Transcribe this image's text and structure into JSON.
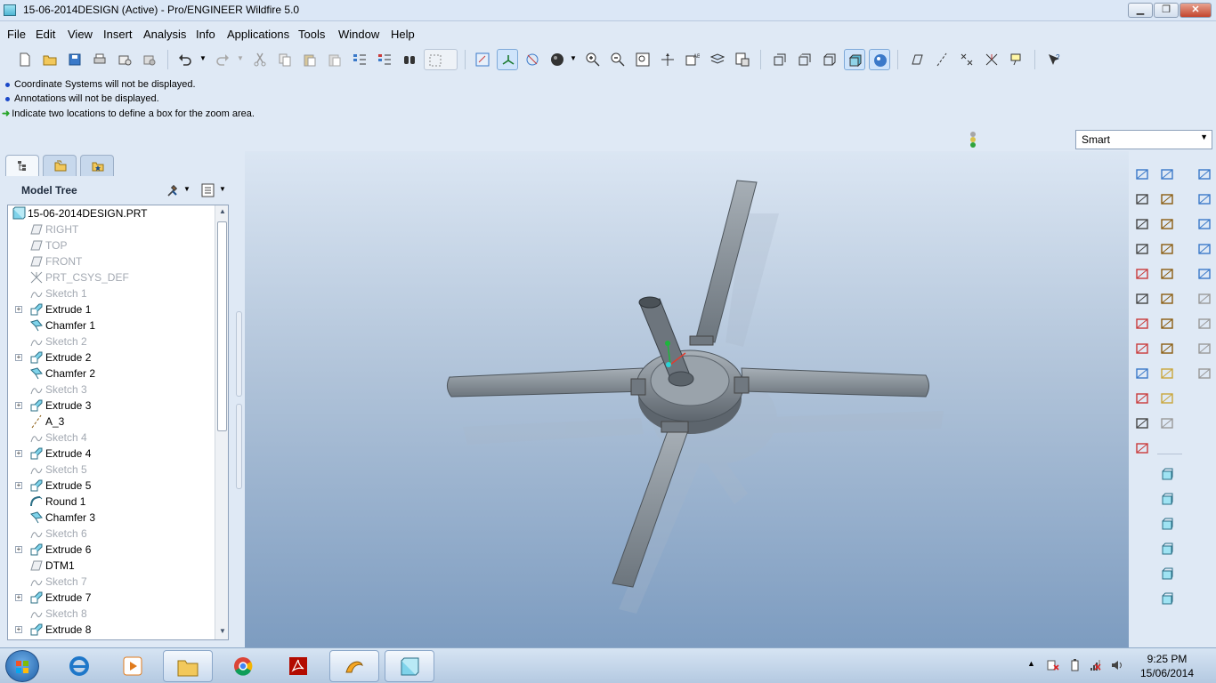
{
  "window": {
    "title": "15-06-2014DESIGN (Active) - Pro/ENGINEER Wildfire 5.0"
  },
  "menu": [
    "File",
    "Edit",
    "View",
    "Insert",
    "Analysis",
    "Info",
    "Applications",
    "Tools",
    "Window",
    "Help"
  ],
  "messages": [
    {
      "type": "info",
      "text": "Coordinate Systems will not be displayed."
    },
    {
      "type": "info",
      "text": "Annotations will not be displayed."
    },
    {
      "type": "prompt",
      "text": "Indicate two locations to define a box for the zoom area."
    }
  ],
  "filter": {
    "value": "Smart"
  },
  "model_tree": {
    "title": "Model Tree",
    "root": "15-06-2014DESIGN.PRT",
    "items": [
      {
        "label": "RIGHT",
        "icon": "datum-plane-icon",
        "dim": true,
        "expandable": false
      },
      {
        "label": "TOP",
        "icon": "datum-plane-icon",
        "dim": true,
        "expandable": false
      },
      {
        "label": "FRONT",
        "icon": "datum-plane-icon",
        "dim": true,
        "expandable": false
      },
      {
        "label": "PRT_CSYS_DEF",
        "icon": "csys-icon",
        "dim": true,
        "expandable": false
      },
      {
        "label": "Sketch 1",
        "icon": "sketch-icon",
        "dim": true,
        "expandable": false
      },
      {
        "label": "Extrude 1",
        "icon": "extrude-icon",
        "dim": false,
        "expandable": true
      },
      {
        "label": "Chamfer 1",
        "icon": "chamfer-icon",
        "dim": false,
        "expandable": false
      },
      {
        "label": "Sketch 2",
        "icon": "sketch-icon",
        "dim": true,
        "expandable": false
      },
      {
        "label": "Extrude 2",
        "icon": "extrude-icon",
        "dim": false,
        "expandable": true
      },
      {
        "label": "Chamfer 2",
        "icon": "chamfer-icon",
        "dim": false,
        "expandable": false
      },
      {
        "label": "Sketch 3",
        "icon": "sketch-icon",
        "dim": true,
        "expandable": false
      },
      {
        "label": "Extrude 3",
        "icon": "extrude-icon",
        "dim": false,
        "expandable": true
      },
      {
        "label": "A_3",
        "icon": "axis-icon",
        "dim": false,
        "expandable": false
      },
      {
        "label": "Sketch 4",
        "icon": "sketch-icon",
        "dim": true,
        "expandable": false
      },
      {
        "label": "Extrude 4",
        "icon": "extrude-icon",
        "dim": false,
        "expandable": true
      },
      {
        "label": "Sketch 5",
        "icon": "sketch-icon",
        "dim": true,
        "expandable": false
      },
      {
        "label": "Extrude 5",
        "icon": "extrude-icon",
        "dim": false,
        "expandable": true
      },
      {
        "label": "Round 1",
        "icon": "round-icon",
        "dim": false,
        "expandable": false
      },
      {
        "label": "Chamfer 3",
        "icon": "chamfer-icon",
        "dim": false,
        "expandable": false
      },
      {
        "label": "Sketch 6",
        "icon": "sketch-icon",
        "dim": true,
        "expandable": false
      },
      {
        "label": "Extrude 6",
        "icon": "extrude-icon",
        "dim": false,
        "expandable": true
      },
      {
        "label": "DTM1",
        "icon": "datum-plane-icon",
        "dim": false,
        "expandable": false
      },
      {
        "label": "Sketch 7",
        "icon": "sketch-icon",
        "dim": true,
        "expandable": false
      },
      {
        "label": "Extrude 7",
        "icon": "extrude-icon",
        "dim": false,
        "expandable": true
      },
      {
        "label": "Sketch 8",
        "icon": "sketch-icon",
        "dim": true,
        "expandable": false
      },
      {
        "label": "Extrude 8",
        "icon": "extrude-icon",
        "dim": false,
        "expandable": true
      }
    ]
  },
  "colors": {
    "viewport_top": "#dbe6f3",
    "viewport_bottom": "#7d9cc0",
    "part": "#8a939c",
    "accent": "#2b6f86"
  },
  "taskbar": {
    "apps": [
      "windows-start-icon",
      "internet-explorer-icon",
      "media-player-icon",
      "file-explorer-icon",
      "chrome-icon",
      "acrobat-icon",
      "proe-icon",
      "proe-part-icon"
    ],
    "time": "9:25 PM",
    "date": "15/06/2014"
  }
}
